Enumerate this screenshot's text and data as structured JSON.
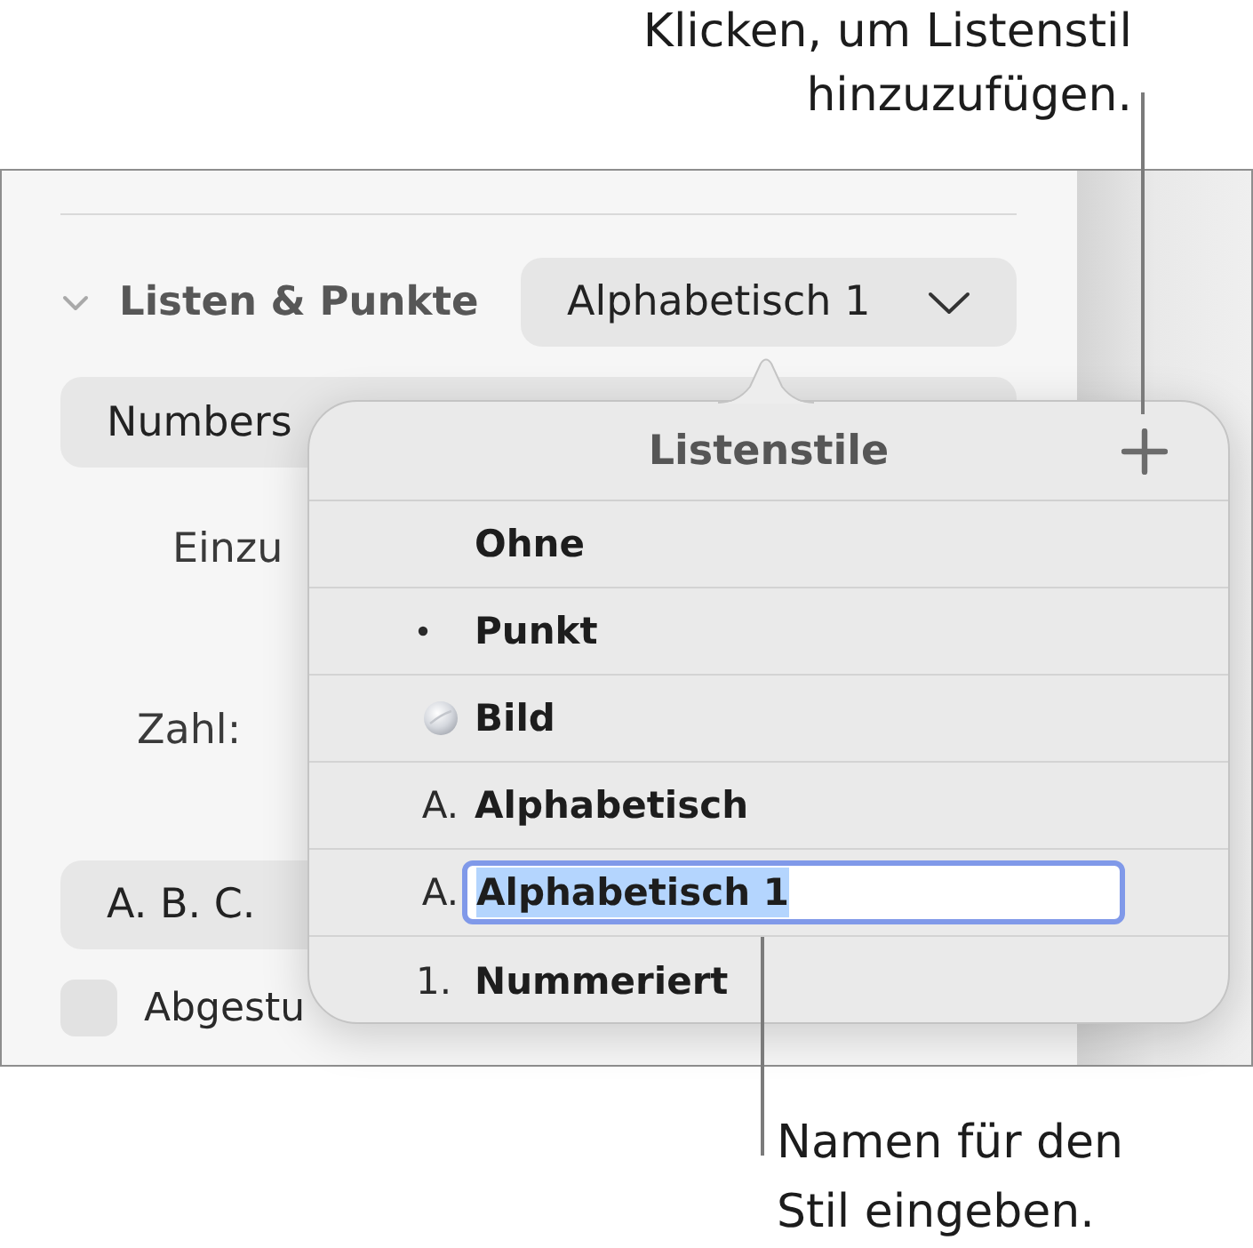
{
  "annotations": [
    {
      "kind": "top",
      "lines": [
        "Klicken, um Listenstil",
        "hinzuzufügen."
      ]
    },
    {
      "kind": "bottom",
      "lines": [
        "Namen für den",
        "Stil eingeben."
      ]
    }
  ],
  "inspector": {
    "section": {
      "title": "Listen & Punkte",
      "expanded": true,
      "style_menu": "Alphabetisch 1"
    },
    "preset_menu": "Numbers",
    "indent_label": "Einzu",
    "number_label": "Zahl:",
    "number_format_menu": "A. B. C.",
    "tiered_numbering": {
      "label": "Abgestu",
      "checked": false
    }
  },
  "popover": {
    "title": "Listenstile",
    "items": [
      {
        "kind": "none",
        "label": "Ohne",
        "editing": false
      },
      {
        "kind": "bullet",
        "label": "Punkt",
        "editing": false
      },
      {
        "kind": "image",
        "label": "Bild",
        "editing": false
      },
      {
        "kind": "letter",
        "marker": "A.",
        "label": "Alphabetisch",
        "editing": false
      },
      {
        "kind": "letter",
        "marker": "A.",
        "label": "Alphabetisch 1",
        "editing": true
      },
      {
        "kind": "number",
        "marker": "1.",
        "label": "Nummeriert",
        "editing": false
      }
    ]
  }
}
